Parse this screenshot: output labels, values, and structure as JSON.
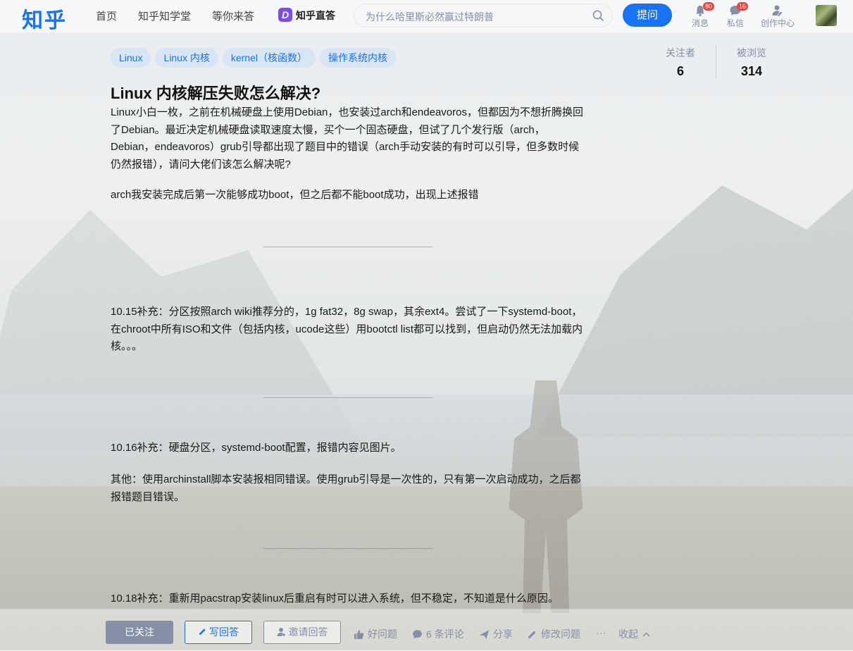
{
  "header": {
    "logo": "知乎",
    "nav": [
      "首页",
      "知乎知学堂",
      "等你来答"
    ],
    "brand_mark": "D",
    "brand_text": "知乎直答",
    "search_placeholder": "为什么哈里斯必然赢过特朗普",
    "ask_label": "提问",
    "notifications": {
      "label": "消息",
      "badge": "80"
    },
    "messages": {
      "label": "私信",
      "badge": "16"
    },
    "creator": {
      "label": "创作中心"
    }
  },
  "tags": [
    "Linux",
    "Linux 内核",
    "kernel（核函数）",
    "操作系统内核"
  ],
  "question": {
    "title": "Linux 内核解压失败怎么解决?",
    "p1": "Linux小白一枚，之前在机械硬盘上使用Debian，也安装过arch和endeavoros，但都因为不想折腾换回了Debian。最近决定机械硬盘读取速度太慢，买个一个固态硬盘，但试了几个发行版（arch，Debian，endeavoros）grub引导都出现了题目中的错误（arch手动安装的有时可以引导，但多数时候仍然报错），请问大佬们该怎么解决呢?",
    "p2": "arch我安装完成后第一次能够成功boot，但之后都不能boot成功，出现上述报错",
    "p3": "10.15补充：分区按照arch wiki推荐分的，1g fat32，8g swap，其余ext4。尝试了一下systemd-boot，在chroot中所有ISO和文件（包括内核，ucode这些）用bootctl list都可以找到，但启动仍然无法加载内核。。。",
    "p4": "10.16补充：硬盘分区，systemd-boot配置，报错内容见图片。",
    "p5": "其他：使用archinstall脚本安装报相同错误。使用grub引导是一次性的，只有第一次启动成功，之后都报错题目错误。",
    "p6": "10.18补充：重新用pacstrap安装linux后重启有时可以进入系统，但不稳定，不知道是什么原因。"
  },
  "stats": {
    "followers_label": "关注者",
    "followers": "6",
    "views_label": "被浏览",
    "views": "314"
  },
  "actions": {
    "followed": "已关注",
    "write_answer": "写回答",
    "invite": "邀请回答",
    "good_question": "好问题",
    "comments": "6 条评论",
    "share": "分享",
    "edit": "修改问题",
    "more": "···",
    "collapse": "收起"
  },
  "colors": {
    "brand": "#1772f6",
    "badge": "#f1403c",
    "muted": "#8590a6"
  }
}
